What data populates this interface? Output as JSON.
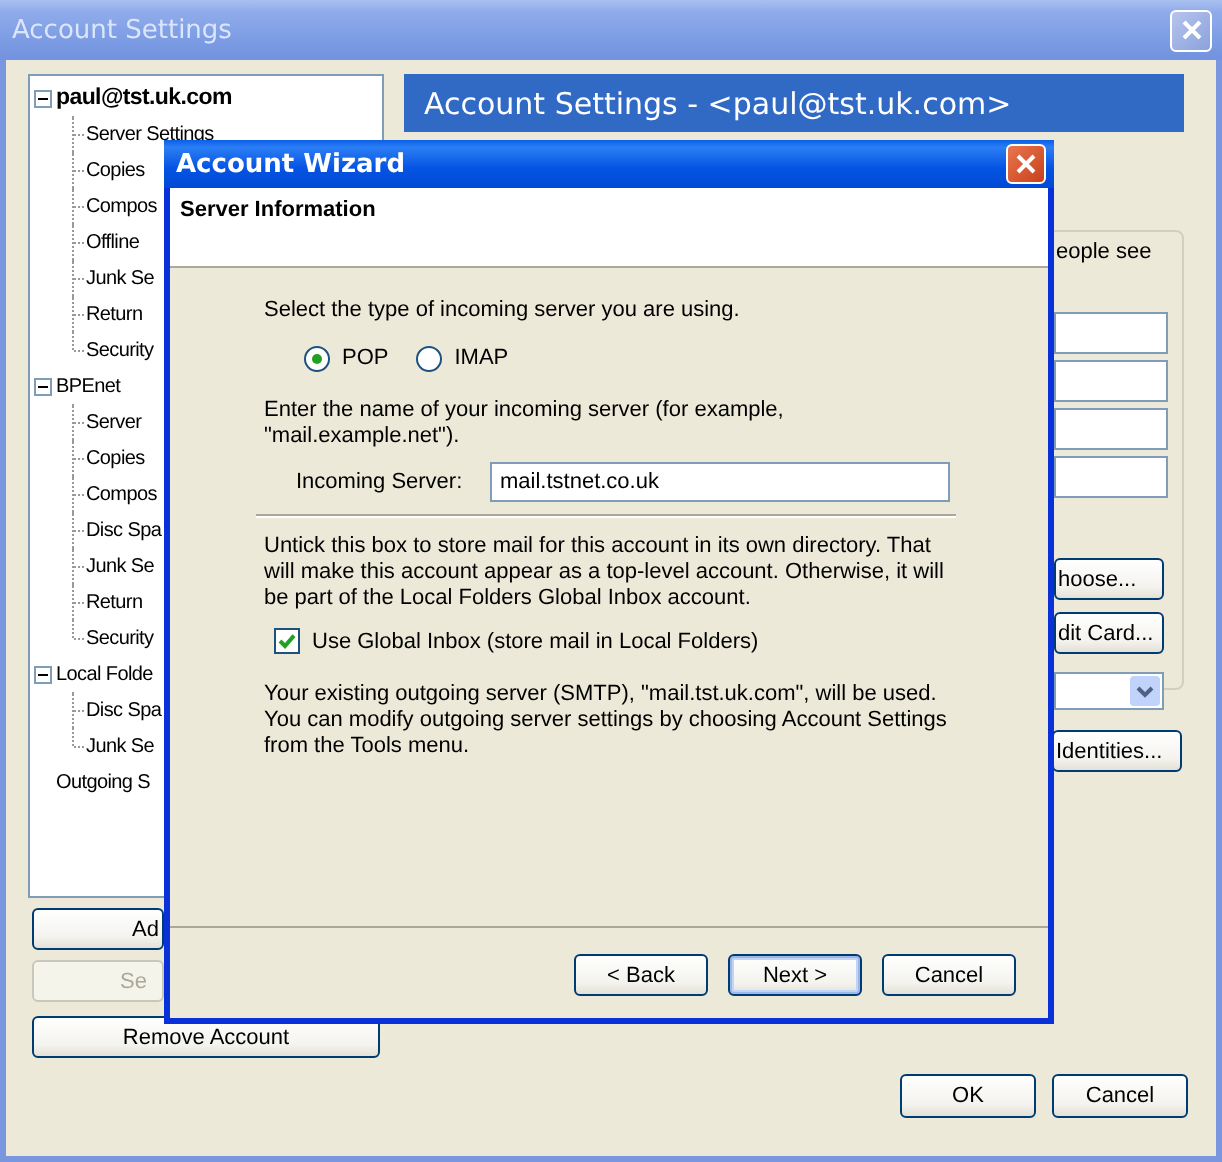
{
  "main_window": {
    "title": "Account Settings",
    "account_tree": [
      {
        "label": "paul@tst.uk.com",
        "selected": true,
        "expanded": true,
        "children": [
          {
            "label": "Server Settings",
            "selected": false
          },
          {
            "label": "Copies",
            "selected": false
          },
          {
            "label": "Compos",
            "selected": false
          },
          {
            "label": "Offline",
            "selected": false
          },
          {
            "label": "Junk Se",
            "selected": false
          },
          {
            "label": "Return",
            "selected": false
          },
          {
            "label": "Security",
            "selected": false
          }
        ]
      },
      {
        "label": "BPEnet",
        "selected": false,
        "expanded": true,
        "children": [
          {
            "label": "Server",
            "selected": false
          },
          {
            "label": "Copies",
            "selected": false
          },
          {
            "label": "Compos",
            "selected": false
          },
          {
            "label": "Disc Spa",
            "selected": false
          },
          {
            "label": "Junk Se",
            "selected": false
          },
          {
            "label": "Return",
            "selected": false
          },
          {
            "label": "Security",
            "selected": false
          }
        ]
      },
      {
        "label": "Local Folde",
        "selected": false,
        "expanded": true,
        "children": [
          {
            "label": "Disc Spa",
            "selected": false
          },
          {
            "label": "Junk Se",
            "selected": false
          }
        ]
      },
      {
        "label": "Outgoing S",
        "selected": false
      }
    ],
    "account_buttons": [
      {
        "label": "Ad",
        "disabled": false
      },
      {
        "label": "Se",
        "disabled": true
      },
      {
        "label": "Remove Account",
        "disabled": false
      }
    ],
    "panel_header": "Account Settings - <paul@tst.uk.com>",
    "panel_text": "eople see",
    "panel_buttons": [
      "hoose...",
      "dit Card..."
    ],
    "identities_button": "Identities...",
    "buttons": [
      "OK",
      "Cancel"
    ]
  },
  "wizard": {
    "title": "Account Wizard",
    "page_title": "Server Information",
    "server_type_prompt": "Select the type of incoming server you are using.",
    "server_types": [
      {
        "label": "POP",
        "selected": true
      },
      {
        "label": "IMAP",
        "selected": false
      }
    ],
    "server_name_prompt": "Enter the name of your incoming server (for example, \"mail.example.net\").",
    "incoming_server": {
      "label": "Incoming Server:",
      "value": "mail.tstnet.co.uk"
    },
    "global_inbox_note": "Untick this box to store mail for this account in its own directory. That will make this account appear as a top-level account. Otherwise, it will be part of the Local Folders Global Inbox account.",
    "global_inbox": {
      "label": "Use Global Inbox (store mail in Local Folders)",
      "checked": true
    },
    "smtp_note": "Your existing outgoing server (SMTP), \"mail.tst.uk.com\", will be used. You can modify outgoing server settings by choosing Account Settings from the Tools menu.",
    "buttons": [
      {
        "label": "< Back",
        "default": false
      },
      {
        "label": "Next >",
        "default": true
      },
      {
        "label": "Cancel",
        "default": false
      }
    ]
  }
}
